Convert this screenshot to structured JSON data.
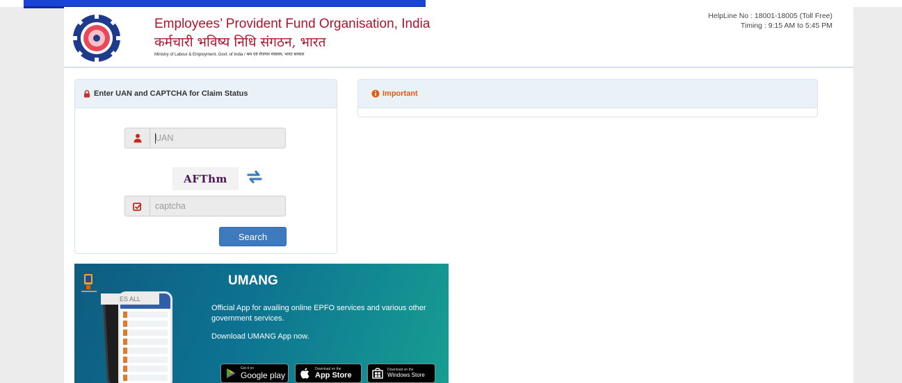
{
  "header": {
    "org_name_en": "Employees’ Provident Fund Organisation, India",
    "org_name_hi": "कर्मचारी भविष्य निधि संगठन, भारत",
    "ministry": "Ministry of Labour & Employment, Govt. of India / श्रम एवं रोजगार मंत्रालय, भारत सरकार",
    "helpline": "HelpLine No : 18001-18005 (Toll Free)",
    "timing": "Timing : 9:15 AM to 5:45 PM"
  },
  "claim_panel": {
    "title": "Enter UAN and CAPTCHA for Claim Status",
    "uan_placeholder": "UAN",
    "uan_value": "",
    "captcha_text": "AFThm",
    "captcha_placeholder": "captcha",
    "captcha_value": "",
    "search_label": "Search"
  },
  "important_panel": {
    "title": "Important"
  },
  "umang": {
    "title": "UMANG",
    "description": "Official App for availing online EPFO services and various other government services.",
    "cta": "Download UMANG App now.",
    "phone_banner": "ES ALL",
    "badges": [
      {
        "small": "Get it on",
        "big": "Google play"
      },
      {
        "small": "Download on the",
        "big": "App Store"
      },
      {
        "small": "Download on the",
        "big": "Windows Store"
      }
    ]
  },
  "colors": {
    "brand_red": "#b2122b",
    "primary_button": "#3d7abe",
    "important_orange": "#e35a12",
    "panel_header_bg": "#eaf2f8"
  },
  "icons": {
    "claim_panel": "lock-icon",
    "important": "info-circle-icon",
    "uan_addon": "user-icon",
    "captcha_addon": "check-square-icon",
    "refresh": "refresh-icon"
  }
}
